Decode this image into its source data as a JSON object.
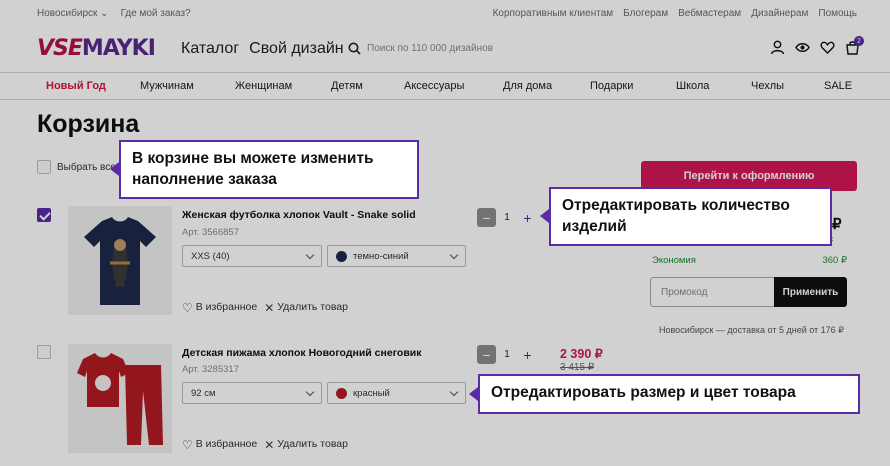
{
  "topbar": {
    "city": "Новосибирск",
    "where_order": "Где мой заказ?",
    "links": [
      "Корпоративным клиентам",
      "Блогерам",
      "Вебмастерам",
      "Дизайнерам",
      "Помощь"
    ]
  },
  "header": {
    "logo_part1": "VSE",
    "logo_part2": "MAYKI",
    "catalog": "Каталог",
    "own_design": "Свой дизайн",
    "search_placeholder": "Поиск по 110 000 дизайнов",
    "cart_count": "2"
  },
  "categories": [
    "Новый Год",
    "Мужчинам",
    "Женщинам",
    "Детям",
    "Аксессуары",
    "Для дома",
    "Подарки",
    "Школа",
    "Чехлы",
    "SALE"
  ],
  "page_title": "Корзина",
  "select_all_label": "Выбрать все",
  "checkout_button": "Перейти к оформлению",
  "items": [
    {
      "name": "Женская футболка хлопок Vault - Snake solid",
      "article": "Арт. 3566857",
      "size": "XXS (40)",
      "color_name": "темно-синий",
      "color_hex": "#1e2a4a",
      "qty": "1",
      "checked": true,
      "favorite": "В избранное",
      "remove": "Удалить товар"
    },
    {
      "name": "Детская пижама хлопок Новогодний снеговик",
      "article": "Арт. 3285317",
      "size": "92 см",
      "color_name": "красный",
      "color_hex": "#b21b22",
      "qty": "1",
      "checked": false,
      "price": "2 390 ₽",
      "old_price": "3 415 ₽",
      "favorite": "В избранное",
      "remove": "Удалить товар"
    }
  ],
  "summary": {
    "total_partial": "₽",
    "old_total_partial": "5 ₽",
    "economy_label": "Экономия",
    "economy_value": "360 ₽",
    "promo_placeholder": "Промокод",
    "apply_button": "Применить",
    "delivery_city": "Новосибирск",
    "delivery_text": " — доставка от 5 дней от ",
    "delivery_price": "176 ₽"
  },
  "callouts": {
    "change_order": "В корзине вы можете изменить наполнение заказа",
    "edit_qty": "Отредактировать количество изделий",
    "edit_size_color": "Отредактировать размер и цвет товара"
  },
  "colors": {
    "accent": "#d3185a",
    "purple": "#5b2ba6"
  }
}
